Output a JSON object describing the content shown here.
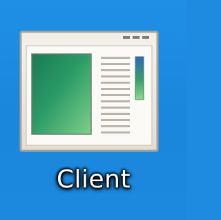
{
  "desktop": {
    "background_color": "#1f8be0",
    "shortcut": {
      "label": "Client",
      "icon": "application-window-icon"
    }
  }
}
